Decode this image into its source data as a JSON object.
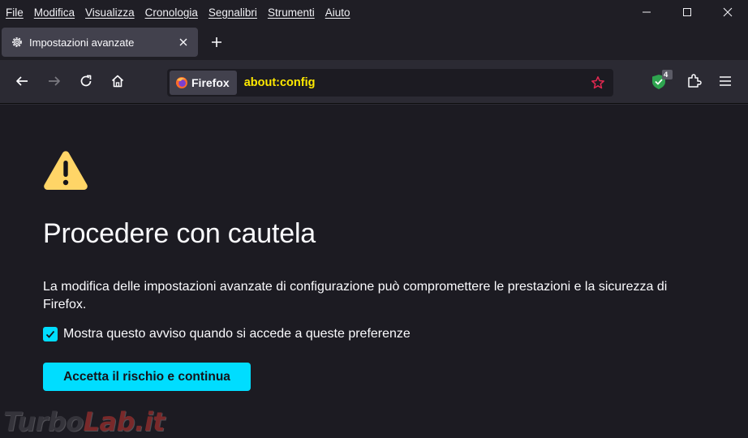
{
  "menubar": {
    "items": [
      {
        "label": "File"
      },
      {
        "label": "Modifica"
      },
      {
        "label": "Visualizza"
      },
      {
        "label": "Cronologia"
      },
      {
        "label": "Segnalibri"
      },
      {
        "label": "Strumenti"
      },
      {
        "label": "Aiuto"
      }
    ]
  },
  "window_controls": {
    "icons": [
      "minimize-icon",
      "maximize-icon",
      "close-icon"
    ]
  },
  "tabs": [
    {
      "label": "Impostazioni avanzate",
      "icon": "gear-icon",
      "active": true
    }
  ],
  "navbar": {
    "identity_label": "Firefox",
    "url": "about:config",
    "extension_badge": "4"
  },
  "content": {
    "title": "Procedere con cautela",
    "description": "La modifica delle impostazioni avanzate di configurazione può compromettere le prestazioni e la sicurezza di Firefox.",
    "checkbox_label": "Mostra questo avviso quando si accede a queste preferenze",
    "checkbox_checked": true,
    "accept_button": "Accetta il rischio e continua"
  },
  "watermark": {
    "text_main": "Turbo",
    "text_accent": "Lab.it"
  },
  "colors": {
    "accent": "#00ddff",
    "url_text": "#ffe900",
    "warning": "#ffd567",
    "background": "#1c1b22",
    "toolbar": "#2b2a33",
    "tabstrip": "#1f1e25"
  }
}
